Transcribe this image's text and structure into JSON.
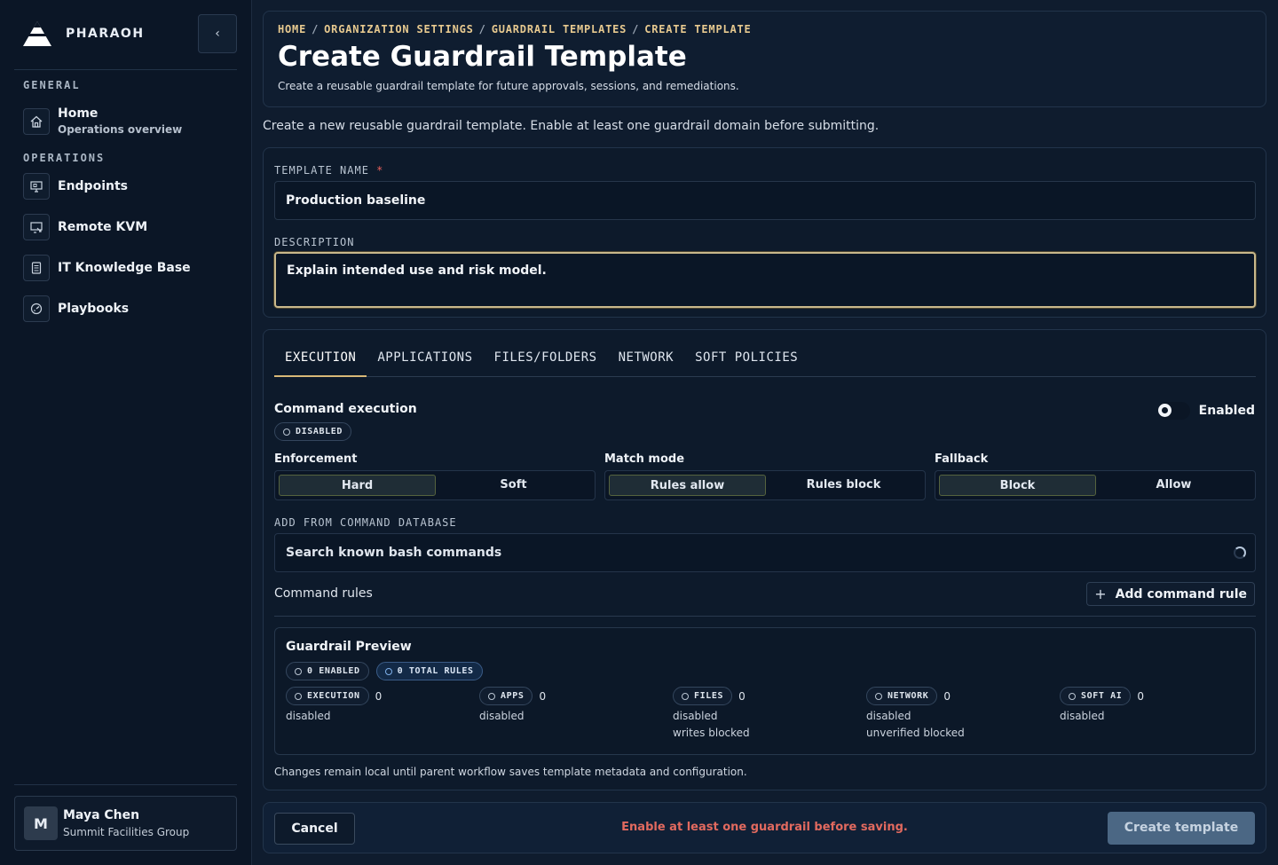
{
  "sidebar": {
    "brand": "PHARAOH",
    "sections": [
      "GENERAL",
      "OPERATIONS"
    ],
    "home": {
      "label": "Home",
      "sub": "Operations overview"
    },
    "items": [
      {
        "label": "Endpoints",
        "icon": "monitor-icon"
      },
      {
        "label": "Remote KVM",
        "icon": "remote-screen-icon"
      },
      {
        "label": "IT Knowledge Base",
        "icon": "book-icon"
      },
      {
        "label": "Playbooks",
        "icon": "gauge-icon"
      }
    ],
    "user": {
      "initial": "M",
      "name": "Maya Chen",
      "org": "Summit Facilities Group"
    }
  },
  "header": {
    "breadcrumb": [
      "HOME",
      "ORGANIZATION SETTINGS",
      "GUARDRAIL TEMPLATES",
      "CREATE TEMPLATE"
    ],
    "title": "Create Guardrail Template",
    "subtitle": "Create a reusable guardrail template for future approvals, sessions, and remediations."
  },
  "intro": "Create a new reusable guardrail template. Enable at least one guardrail domain before submitting.",
  "form": {
    "name_label": "TEMPLATE NAME",
    "required_mark": "*",
    "name_value": "Production baseline",
    "desc_label": "DESCRIPTION",
    "desc_value": "Explain intended use and risk model."
  },
  "tabs": [
    "EXECUTION",
    "APPLICATIONS",
    "FILES/FOLDERS",
    "NETWORK",
    "SOFT POLICIES"
  ],
  "execution": {
    "title": "Command execution",
    "toggle_label": "Enabled",
    "status": "DISABLED",
    "enforcement": {
      "label": "Enforcement",
      "options": [
        "Hard",
        "Soft"
      ],
      "selected": "Hard"
    },
    "match_mode": {
      "label": "Match mode",
      "options": [
        "Rules allow",
        "Rules block"
      ],
      "selected": "Rules allow"
    },
    "fallback": {
      "label": "Fallback",
      "options": [
        "Block",
        "Allow"
      ],
      "selected": "Block"
    },
    "db_label": "ADD FROM COMMAND DATABASE",
    "search_placeholder": "Search known bash commands",
    "rules_label": "Command rules",
    "add_rule": "Add command rule"
  },
  "preview": {
    "title": "Guardrail Preview",
    "enabled_pill": "0 ENABLED",
    "total_pill": "0 TOTAL RULES",
    "domains": [
      {
        "name": "EXECUTION",
        "count": "0",
        "lines": [
          "disabled"
        ]
      },
      {
        "name": "APPS",
        "count": "0",
        "lines": [
          "disabled"
        ]
      },
      {
        "name": "FILES",
        "count": "0",
        "lines": [
          "disabled",
          "writes blocked"
        ]
      },
      {
        "name": "NETWORK",
        "count": "0",
        "lines": [
          "disabled",
          "unverified blocked"
        ]
      },
      {
        "name": "SOFT AI",
        "count": "0",
        "lines": [
          "disabled"
        ]
      }
    ]
  },
  "note": "Changes remain local until parent workflow saves template metadata and configuration.",
  "footer": {
    "cancel": "Cancel",
    "warning": "Enable at least one guardrail before saving.",
    "create": "Create template"
  },
  "colors": {
    "accent": "#d8b877",
    "warning": "#e26a5f",
    "primary_disabled": "#4b6784"
  }
}
